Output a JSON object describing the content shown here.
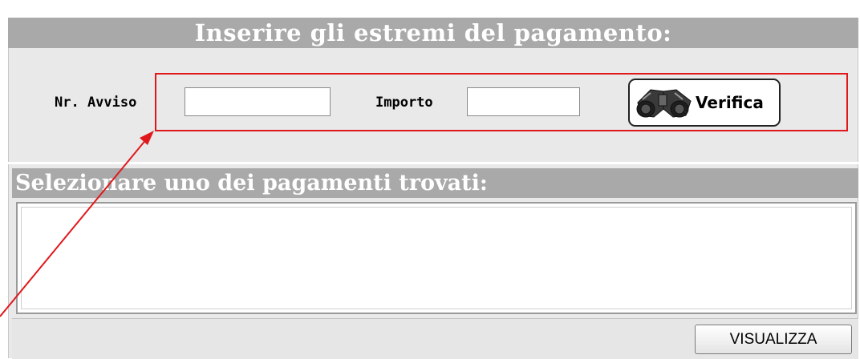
{
  "payment_form": {
    "title": "Inserire gli estremi del pagamento:",
    "avviso_label": "Nr. Avviso",
    "avviso_value": "",
    "importo_label": "Importo",
    "importo_value": "",
    "verifica_label": "Verifica",
    "verifica_icon": "binoculars-icon"
  },
  "results": {
    "title": "Selezionare uno dei pagamenti trovati:",
    "items": [],
    "visualizza_label": "VISUALIZZA"
  },
  "annotation": {
    "color": "#e0181c"
  }
}
